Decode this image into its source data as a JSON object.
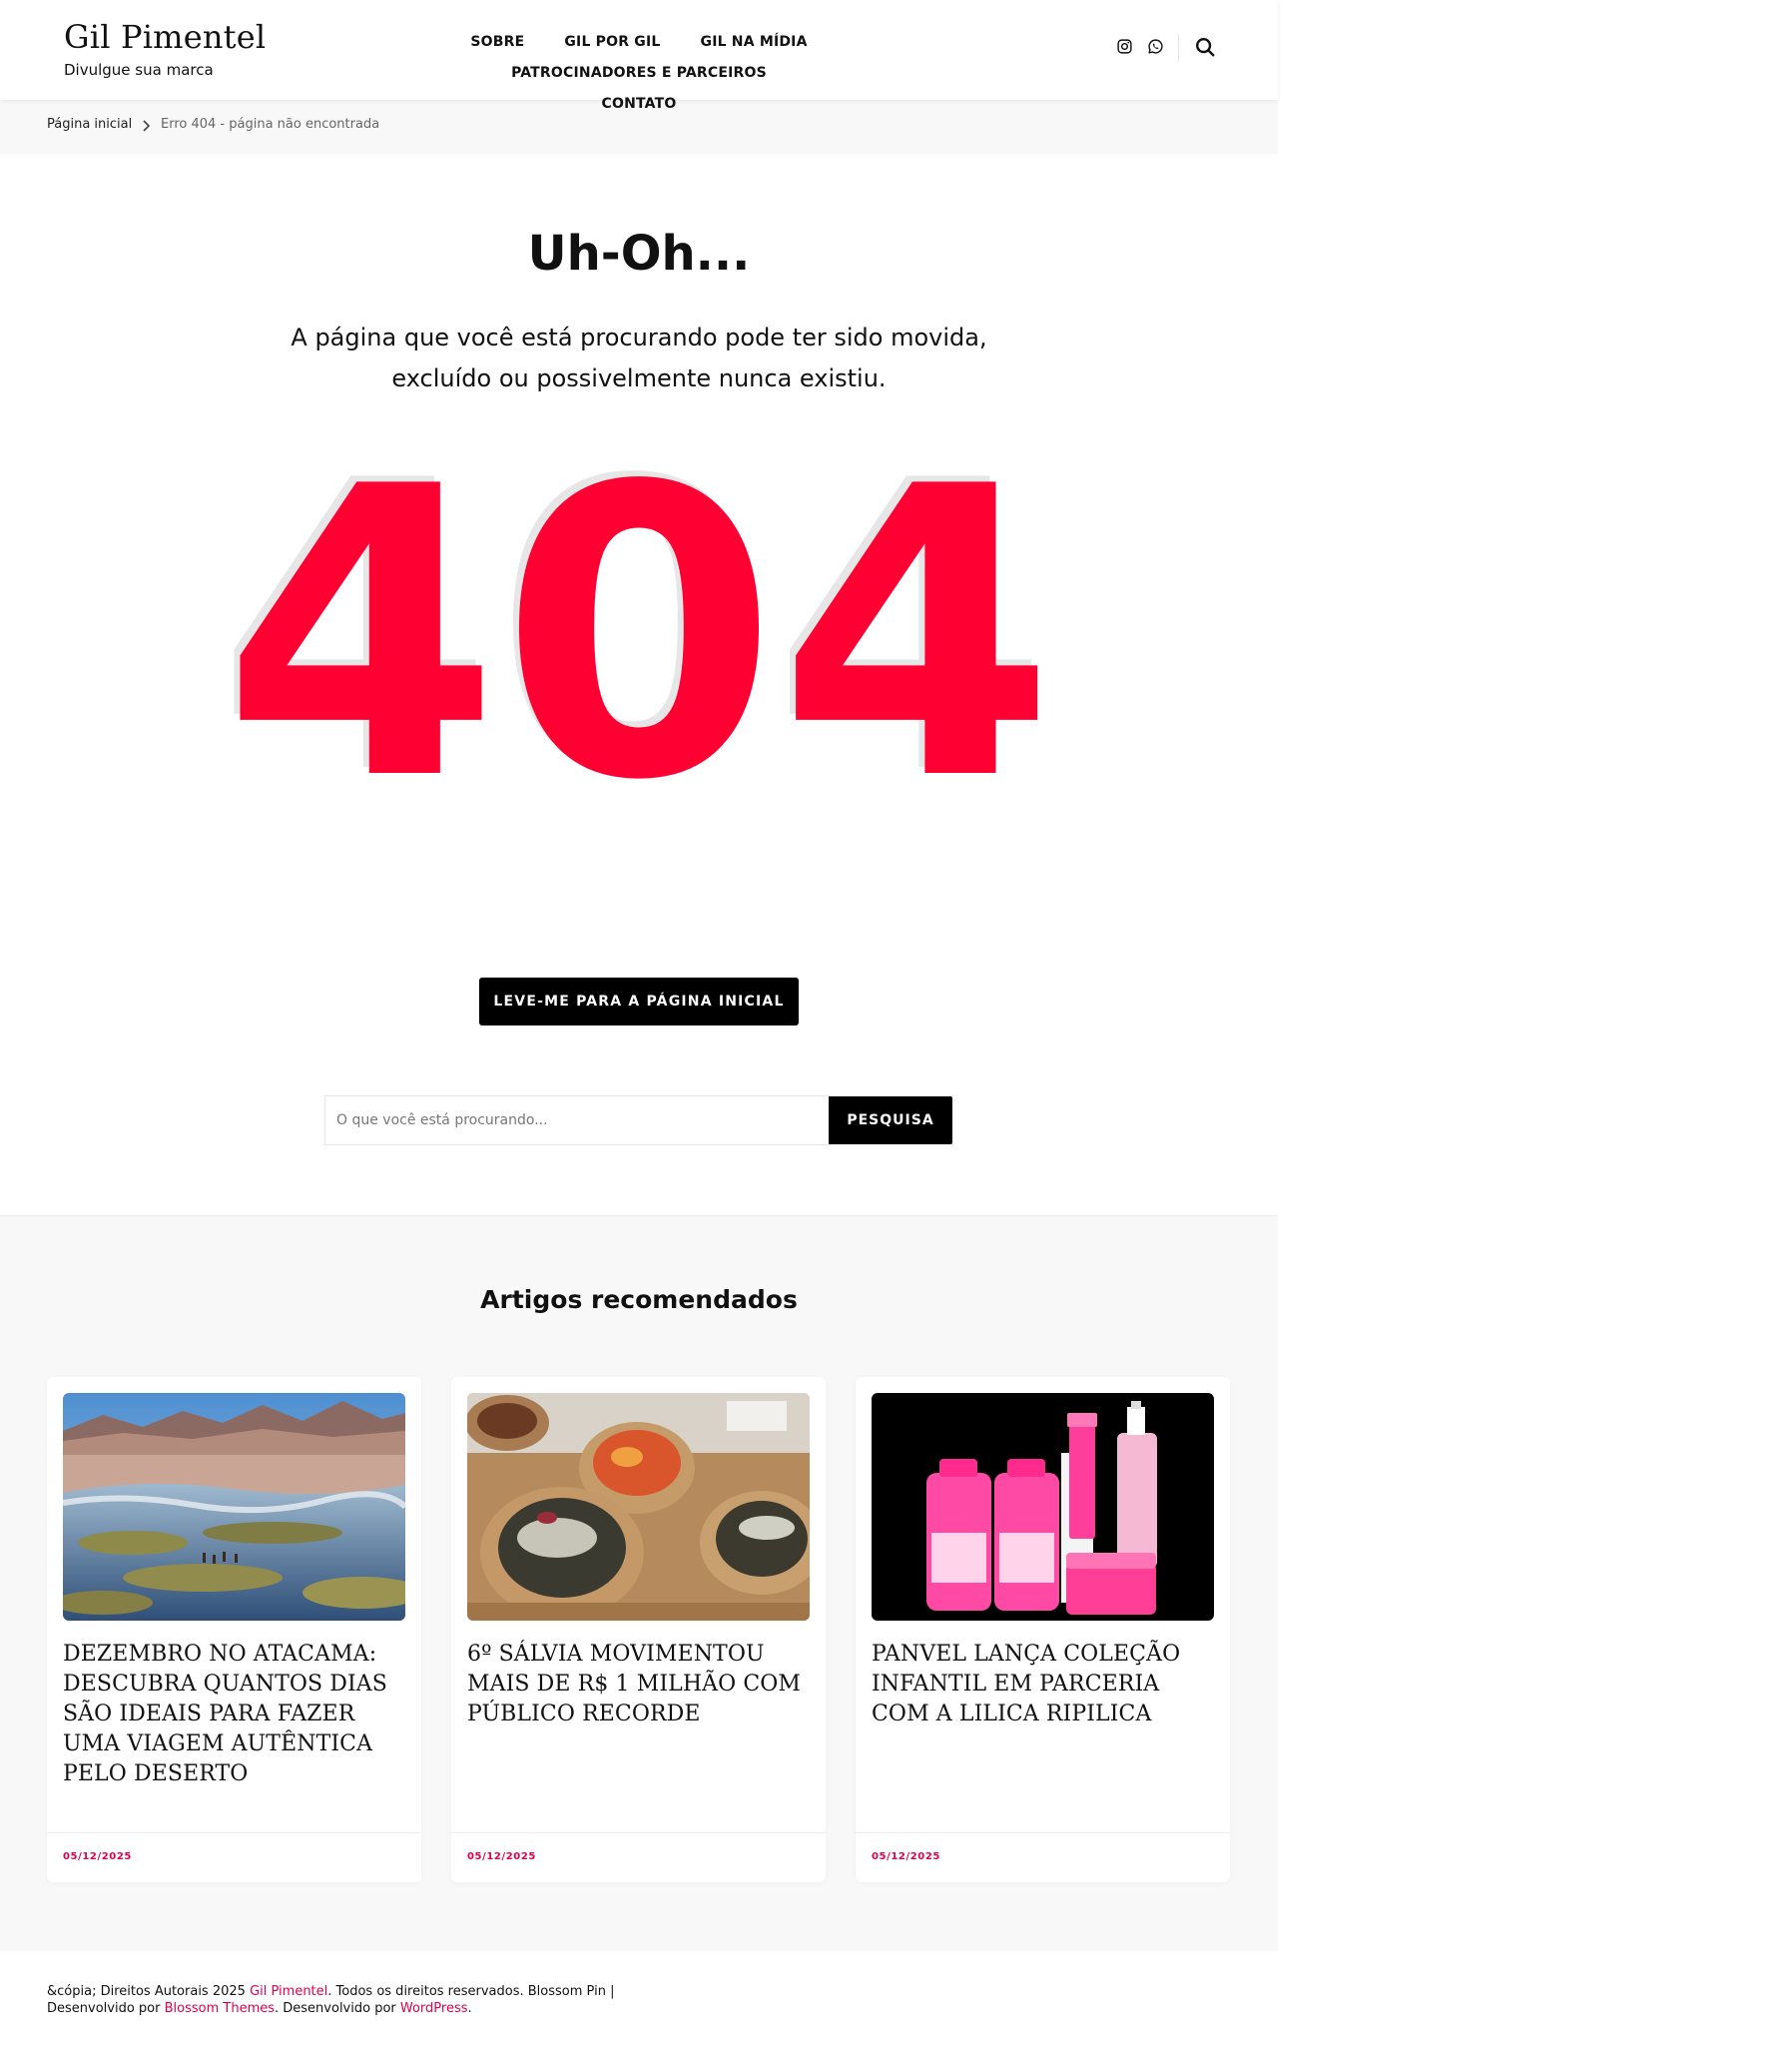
{
  "header": {
    "site_title": "Gil Pimentel",
    "tagline": "Divulgue sua marca",
    "nav": [
      "SOBRE",
      "GIL POR GIL",
      "GIL NA MÍDIA",
      "PATROCINADORES E PARCEIROS",
      "CONTATO"
    ],
    "social_icons": [
      "instagram-icon",
      "whatsapp-icon"
    ],
    "search_icon": "search-icon"
  },
  "breadcrumb": {
    "home": "Página inicial",
    "current": "Erro 404 - página não encontrada"
  },
  "error": {
    "heading": "Uh-Oh...",
    "message": "A página que você está procurando pode ter sido movida, excluído ou possivelmente nunca existiu.",
    "code": "404",
    "code_color": "#ff0033",
    "home_button": "LEVE-ME PARA A PÁGINA INICIAL",
    "search_placeholder": "O que você está procurando...",
    "search_button": "PESQUISA"
  },
  "recommended": {
    "title": "Artigos recomendados",
    "articles": [
      {
        "title": "Dezembro no Atacama: descubra quantos dias são ideais para fazer uma viagem autêntica pelo deserto",
        "date": "05/12/2025"
      },
      {
        "title": "6º Sálvia movimentou mais de R$ 1 milhão com público recorde",
        "date": "05/12/2025"
      },
      {
        "title": "Panvel lança coleção infantil em parceria com a Lilica Ripilica",
        "date": "05/12/2025"
      }
    ]
  },
  "footer": {
    "prefix": "&cópia; Direitos Autorais 2025 ",
    "site_link": "Gil Pimentel",
    "middle": ". Todos os direitos reservados. Blossom Pin | Desenvolvido por ",
    "theme_link": "Blossom Themes",
    "after_theme": ". Desenvolvido por ",
    "wp_link": "WordPress",
    "end": "."
  },
  "colors": {
    "accent": "#e0004d",
    "button_bg": "#000000",
    "section_bg": "#f8f8f8"
  }
}
